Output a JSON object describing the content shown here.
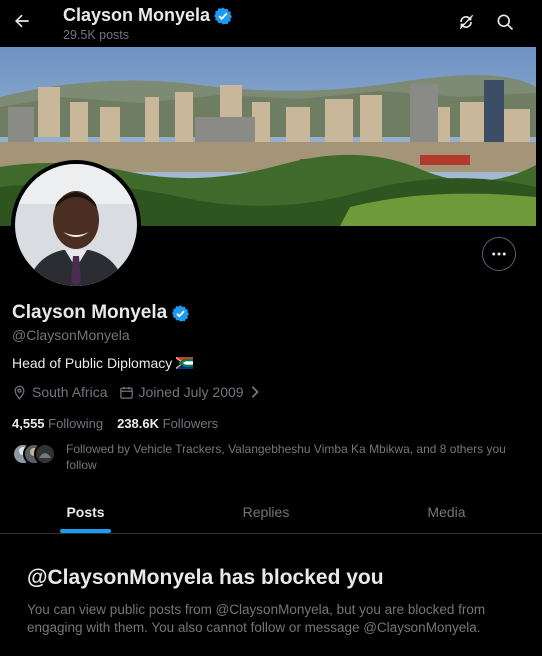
{
  "header": {
    "name": "Clayson Monyela",
    "post_count": "29.5K posts",
    "back_icon": "arrow-left-icon",
    "refresh_icon": "refresh-icon",
    "search_icon": "search-icon"
  },
  "profile": {
    "name": "Clayson Monyela",
    "handle": "@ClaysonMonyela",
    "bio": "Head of Public Diplomacy",
    "bio_flag": "south-africa-flag-icon",
    "location": "South Africa",
    "joined": "Joined July 2009",
    "following_count": "4,555",
    "following_label": "Following",
    "followers_count": "238.6K",
    "followers_label": "Followers",
    "followed_by": "Followed by Vehicle Trackers, Valangebheshu Vimba Ka Mbikwa, and 8 others you follow"
  },
  "tabs": [
    {
      "label": "Posts",
      "active": true
    },
    {
      "label": "Replies",
      "active": false
    },
    {
      "label": "Media",
      "active": false
    }
  ],
  "blocked": {
    "title": "@ClaysonMonyela has blocked you",
    "description": "You can view public posts from @ClaysonMonyela, but you are blocked from engaging with them. You also cannot follow or message @ClaysonMonyela."
  },
  "colors": {
    "background": "#000000",
    "accent": "#1d9bf0",
    "text_primary": "#e7e9ea",
    "text_secondary": "#71767b",
    "verified": "#1d9bf0"
  }
}
